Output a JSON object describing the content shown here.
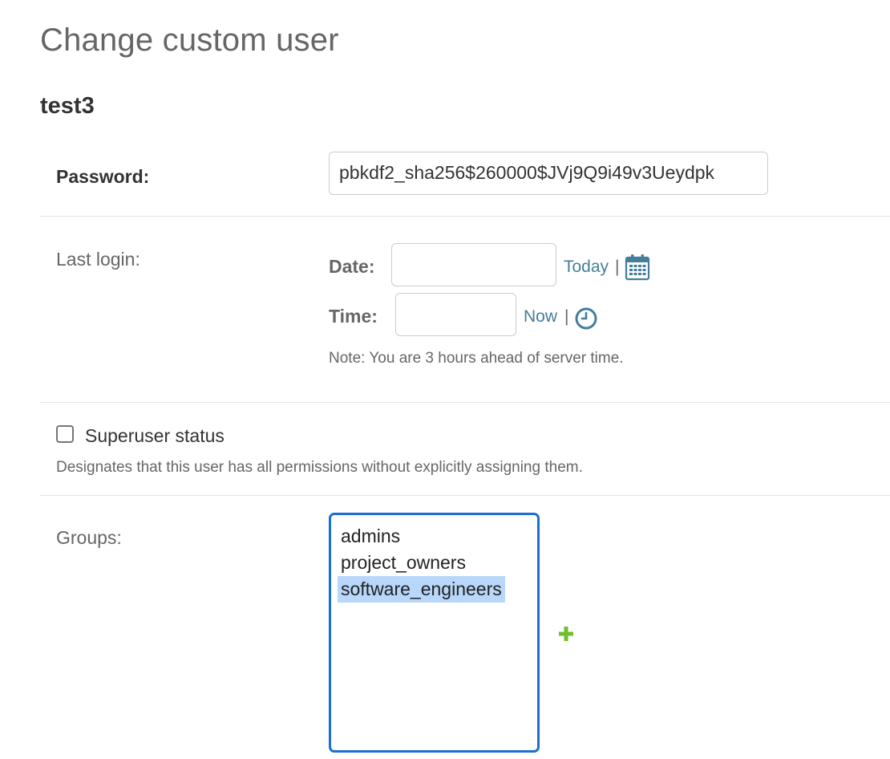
{
  "header": {
    "title": "Change custom user",
    "object_name": "test3"
  },
  "password": {
    "label": "Password:",
    "value": "pbkdf2_sha256$260000$JVj9Q9i49v3Ueydpk"
  },
  "last_login": {
    "label": "Last login:",
    "date_label": "Date:",
    "date_value": "",
    "today_link": "Today",
    "time_label": "Time:",
    "time_value": "",
    "now_link": "Now",
    "separator": "|",
    "note": "Note: You are 3 hours ahead of server time.",
    "calendar_icon": "calendar-icon",
    "clock_icon": "clock-icon"
  },
  "superuser": {
    "label": "Superuser status",
    "checked": false,
    "help": "Designates that this user has all permissions without explicitly assigning them."
  },
  "groups": {
    "label": "Groups:",
    "options": [
      {
        "label": "admins",
        "selected": false
      },
      {
        "label": "project_owners",
        "selected": false
      },
      {
        "label": "software_engineers",
        "selected": true
      }
    ],
    "add_icon": "add-plus-icon"
  },
  "colors": {
    "link": "#447e9b",
    "focus_border": "#1a6fd1",
    "selection": "#b8d7fb",
    "add_icon": "#70bf2b"
  }
}
